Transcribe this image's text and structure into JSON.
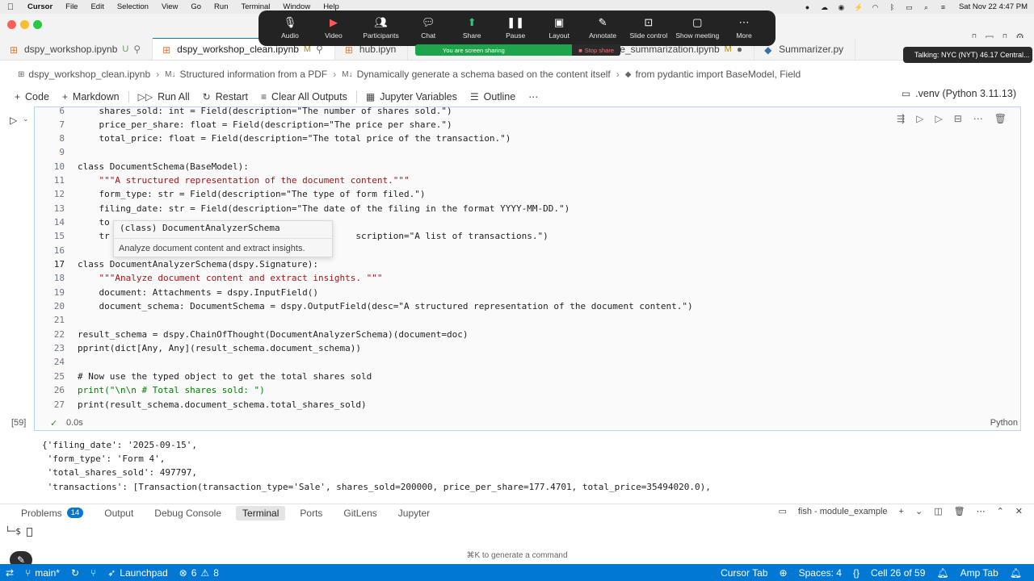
{
  "menubar": {
    "app": "Cursor",
    "items": [
      "File",
      "Edit",
      "Selection",
      "View",
      "Go",
      "Run",
      "Terminal",
      "Window",
      "Help"
    ],
    "clock": "Sat Nov 22  4:47 PM"
  },
  "zoom": {
    "buttons": [
      "Audio",
      "Video",
      "Participants",
      "Chat",
      "Share",
      "Pause",
      "Layout",
      "Annotate",
      "Slide control",
      "Show meeting",
      "More"
    ],
    "participants_count": "2",
    "sharing_text": "You are screen sharing",
    "stop_share": "Stop share",
    "talking": "Talking: NYC (NYT) 46.17 Central..."
  },
  "tabs": [
    {
      "label": "dspy_workshop.ipynb",
      "mod": "U"
    },
    {
      "label": "dspy_workshop_clean.ipynb",
      "mod": "M"
    },
    {
      "label": "hub.ipyn",
      "mod": ""
    },
    {
      "label": "e_summarization.ipynb",
      "mod": "M"
    },
    {
      "label": "Summarizer.py",
      "mod": ""
    }
  ],
  "breadcrumb": [
    "dspy_workshop_clean.ipynb",
    "Structured information from a PDF",
    "Dynamically generate a schema based on the content itself",
    "from pydantic import BaseModel, Field"
  ],
  "toolbar": {
    "code": "Code",
    "markdown": "Markdown",
    "run_all": "Run All",
    "restart": "Restart",
    "clear_outputs": "Clear All Outputs",
    "variables": "Jupyter Variables",
    "outline": "Outline",
    "kernel": ".venv (Python 3.11.13)"
  },
  "code_lines": [
    {
      "n": "6",
      "text": "    shares_sold: int = Field(description=\"The number of shares sold.\")"
    },
    {
      "n": "7",
      "text": "    price_per_share: float = Field(description=\"The price per share.\")"
    },
    {
      "n": "8",
      "text": "    total_price: float = Field(description=\"The total price of the transaction.\")"
    },
    {
      "n": "9",
      "text": ""
    },
    {
      "n": "10",
      "text": "class DocumentSchema(BaseModel):"
    },
    {
      "n": "11",
      "text": "    \"\"\"A structured representation of the document content.\"\"\""
    },
    {
      "n": "12",
      "text": "    form_type: str = Field(description=\"The type of form filed.\")"
    },
    {
      "n": "13",
      "text": "    filing_date: str = Field(description=\"The date of the filing in the format YYYY-MM-DD.\")"
    },
    {
      "n": "14",
      "text": "    to"
    },
    {
      "n": "15",
      "text": "    tr                                              scription=\"A list of transactions.\")"
    },
    {
      "n": "16",
      "text": ""
    },
    {
      "n": "17",
      "text": "class DocumentAnalyzerSchema(dspy.Signature):"
    },
    {
      "n": "18",
      "text": "    \"\"\"Analyze document content and extract insights. \"\"\""
    },
    {
      "n": "19",
      "text": "    document: Attachments = dspy.InputField()"
    },
    {
      "n": "20",
      "text": "    document_schema: DocumentSchema = dspy.OutputField(desc=\"A structured representation of the document content.\")"
    },
    {
      "n": "21",
      "text": ""
    },
    {
      "n": "22",
      "text": "result_schema = dspy.ChainOfThought(DocumentAnalyzerSchema)(document=doc)"
    },
    {
      "n": "23",
      "text": "pprint(dict[Any, Any](result_schema.document_schema))"
    },
    {
      "n": "24",
      "text": ""
    },
    {
      "n": "25",
      "text": "# Now use the typed object to get the total shares sold"
    },
    {
      "n": "26",
      "text": "print(\"\\n\\n # Total shares sold: \")"
    },
    {
      "n": "27",
      "text": "print(result_schema.document_schema.total_shares_sold)"
    }
  ],
  "hover": {
    "signature": "(class) DocumentAnalyzerSchema",
    "doc": "Analyze document content and extract insights."
  },
  "cell": {
    "exec_count": "[59]",
    "duration": "0.0s",
    "language": "Python"
  },
  "output_lines": [
    "{'filing_date': '2025-09-15',",
    " 'form_type': 'Form 4',",
    " 'total_shares_sold': 497797,",
    " 'transactions': [Transaction(transaction_type='Sale', shares_sold=200000, price_per_share=177.4701, total_price=35494020.0),"
  ],
  "panel": {
    "problems": "Problems",
    "problems_count": "14",
    "output": "Output",
    "debug": "Debug Console",
    "terminal": "Terminal",
    "ports": "Ports",
    "gitlens": "GitLens",
    "jupyter": "Jupyter",
    "shell": "fish - module_example",
    "prompt": "└─$",
    "hint": "⌘K to generate a command"
  },
  "statusbar": {
    "branch": "main*",
    "launchpad": "Launchpad",
    "errors": "6",
    "warnings": "8",
    "cursor_tab": "Cursor Tab",
    "spaces": "Spaces: 4",
    "cell": "Cell 26 of 59",
    "amp": "Amp Tab"
  },
  "colors": {
    "accent": "#0078d4",
    "zoom_bg": "#232323",
    "share_green": "#1ea44a",
    "keyword": "#0000ff",
    "string": "#a31515",
    "class": "#267f99"
  }
}
